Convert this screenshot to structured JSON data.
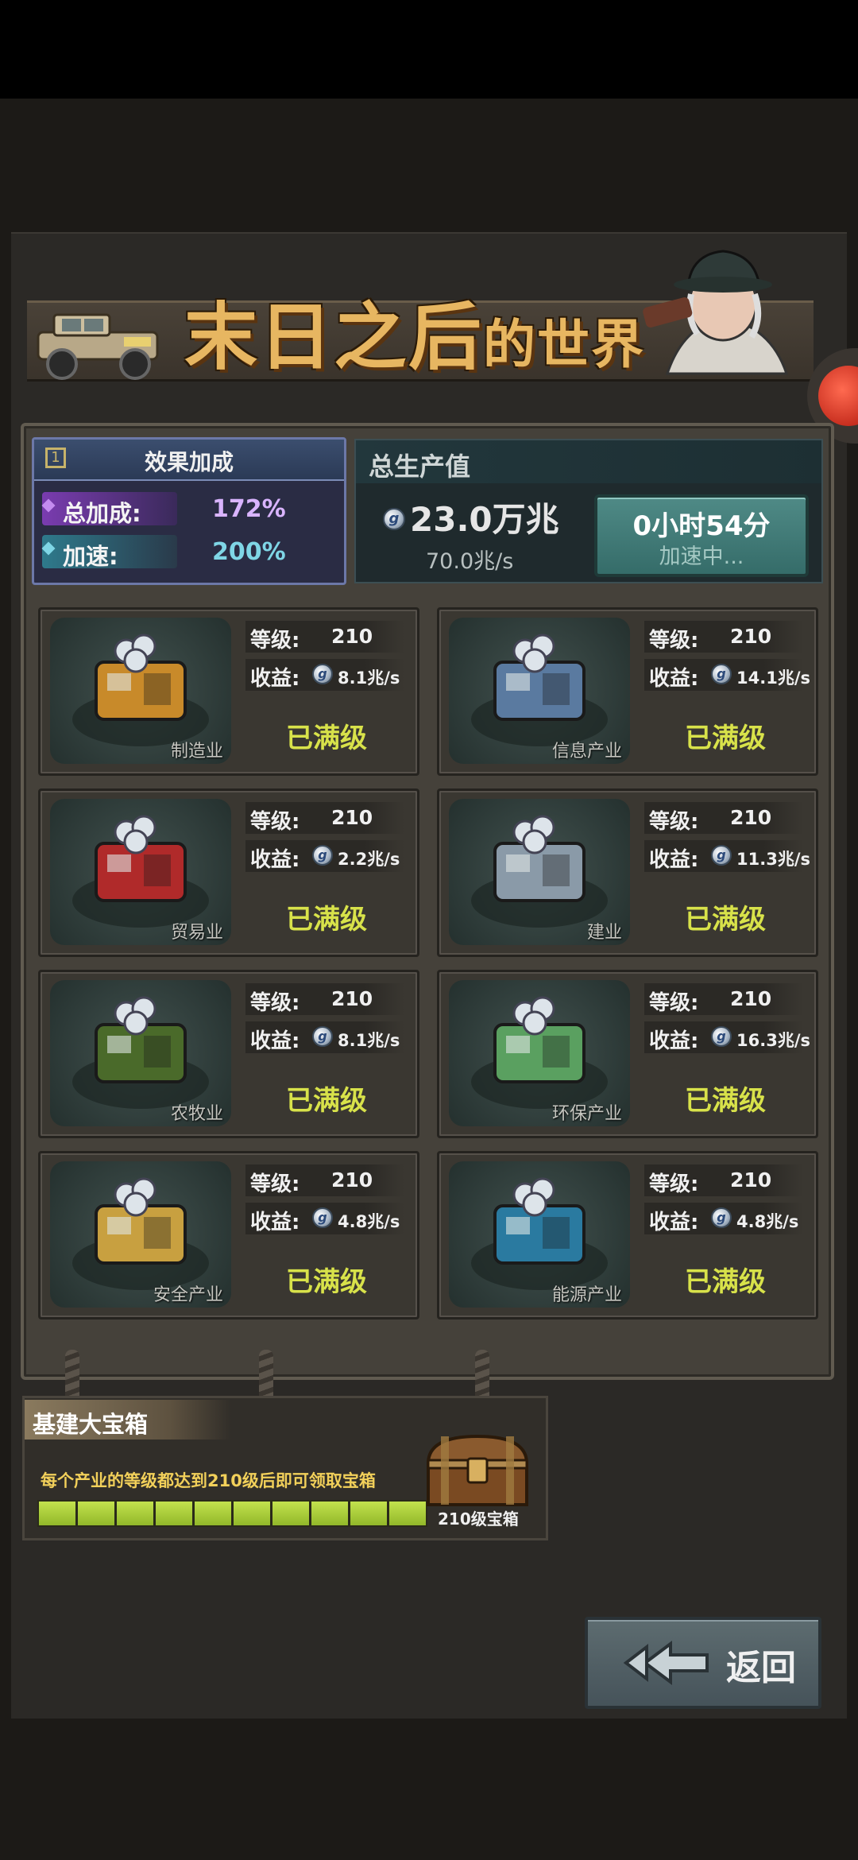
{
  "title": {
    "main": "末日之后",
    "suffix": "的世界"
  },
  "bonus": {
    "header": "效果加成",
    "total_label": "总加成:",
    "total_value": "172%",
    "speed_label": "加速:",
    "speed_value": "200%"
  },
  "production": {
    "header": "总生产值",
    "amount": "23.0万兆",
    "rate": "70.0兆/s",
    "timer": "0小时54分",
    "status": "加速中..."
  },
  "cards": [
    {
      "name": "制造业",
      "level_label": "等级:",
      "level": "210",
      "income_label": "收益:",
      "income": "8.1兆/s",
      "status": "已满级"
    },
    {
      "name": "信息产业",
      "level_label": "等级:",
      "level": "210",
      "income_label": "收益:",
      "income": "14.1兆/s",
      "status": "已满级"
    },
    {
      "name": "贸易业",
      "level_label": "等级:",
      "level": "210",
      "income_label": "收益:",
      "income": "2.2兆/s",
      "status": "已满级"
    },
    {
      "name": "建业",
      "level_label": "等级:",
      "level": "210",
      "income_label": "收益:",
      "income": "11.3兆/s",
      "status": "已满级"
    },
    {
      "name": "农牧业",
      "level_label": "等级:",
      "level": "210",
      "income_label": "收益:",
      "income": "8.1兆/s",
      "status": "已满级"
    },
    {
      "name": "环保产业",
      "level_label": "等级:",
      "level": "210",
      "income_label": "收益:",
      "income": "16.3兆/s",
      "status": "已满级"
    },
    {
      "name": "安全产业",
      "level_label": "等级:",
      "level": "210",
      "income_label": "收益:",
      "income": "4.8兆/s",
      "status": "已满级"
    },
    {
      "name": "能源产业",
      "level_label": "等级:",
      "level": "210",
      "income_label": "收益:",
      "income": "4.8兆/s",
      "status": "已满级"
    }
  ],
  "treasure": {
    "title": "基建大宝箱",
    "description": "每个产业的等级都达到210级后即可领取宝箱",
    "progress_segments_filled": 10,
    "progress_segments_total": 10,
    "chest_label": "210级宝箱"
  },
  "back_button": {
    "label": "返回"
  },
  "colors": {
    "max_level": "#d8e24a",
    "speed_button": "#4f8a86",
    "bonus_total": "#d9b4ff",
    "bonus_speed": "#7fd6e6"
  }
}
